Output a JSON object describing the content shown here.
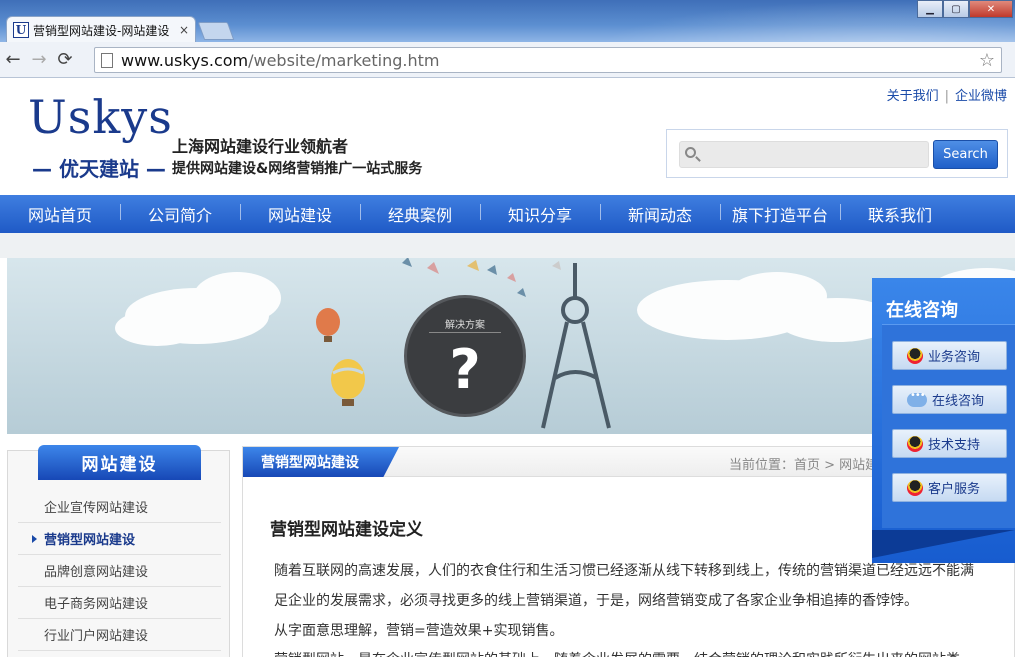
{
  "browser": {
    "tab_title": "营销型网站建设-网站建设",
    "tab_close": "×",
    "favicon_letter": "U",
    "url_host": "www.uskys.com",
    "url_path": "/website/marketing.htm",
    "back": "←",
    "forward": "→",
    "reload": "⟳",
    "star": "☆",
    "min": "▁",
    "max": "▢",
    "close": "✕"
  },
  "header": {
    "logo_en": "Uskys",
    "logo_cn": "— 优天建站 —",
    "tagline1": "上海网站建设行业领航者",
    "tagline2": "提供网站建设&网络营销推广一站式服务",
    "top_links": [
      "关于我们",
      "企业微博"
    ],
    "top_sep": "|",
    "search_placeholder": "",
    "search_button": "Search"
  },
  "nav": {
    "items": [
      "网站首页",
      "公司简介",
      "网站建设",
      "经典案例",
      "知识分享",
      "新闻动态",
      "旗下打造平台",
      "联系我们"
    ]
  },
  "banner": {
    "bubble_label": "解决方案",
    "bubble_mark": "?"
  },
  "sidebar": {
    "title": "网站建设",
    "items": [
      "企业宣传网站建设",
      "营销型网站建设",
      "品牌创意网站建设",
      "电子商务网站建设",
      "行业门户网站建设"
    ],
    "active_index": 1
  },
  "content": {
    "tab": "营销型网站建设",
    "breadcrumb": "当前位置：首页 > 网站建",
    "title": "营销型网站建设定义",
    "paragraphs": [
      "随着互联网的高速发展，人们的衣食住行和生活习惯已经逐渐从线下转移到线上，传统的营销渠道已经远远不能满",
      "足企业的发展需求，必须寻找更多的线上营销渠道，于是，网络营销变成了各家企业争相追捧的香饽饽。",
      "从字面意思理解，营销=营造效果+实现销售。",
      "营销型网站，是在企业宣传型网站的基础上，随着企业发展的需要，结合营销的理论和实践所衍生出来的网站类"
    ]
  },
  "consult": {
    "title": "在线咨询",
    "buttons": [
      "业务咨询",
      "在线咨询",
      "技术支持",
      "客户服务"
    ],
    "icons": [
      "qq-icon",
      "chat-icon",
      "qq-icon",
      "qq-icon"
    ]
  },
  "colors": {
    "brand_blue": "#1a3a8c",
    "nav_blue": "#2f6ad4"
  }
}
